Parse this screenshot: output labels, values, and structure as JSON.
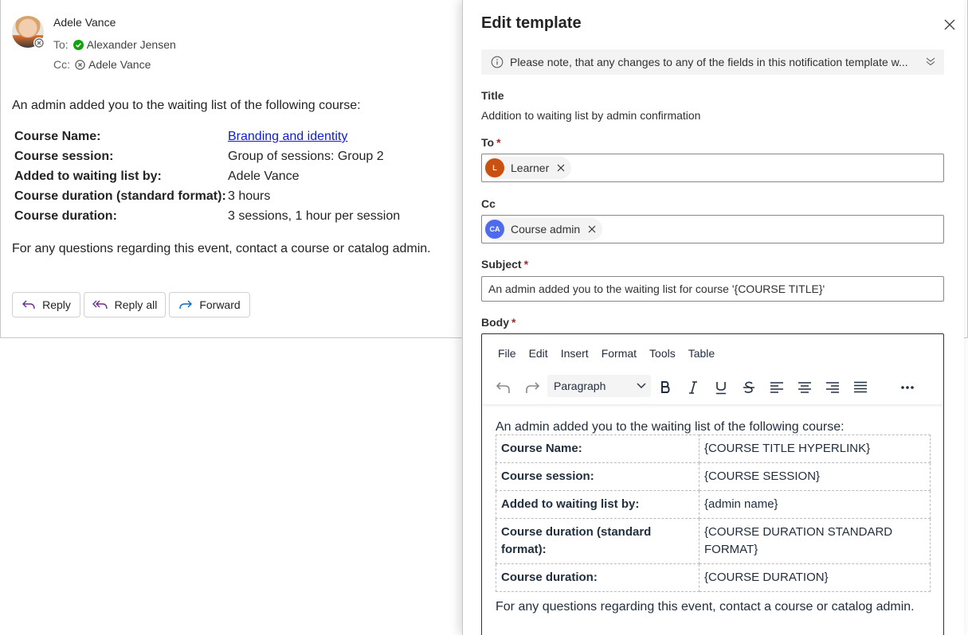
{
  "email": {
    "sender": "Adele Vance",
    "to_label": "To:",
    "to_name": "Alexander Jensen",
    "cc_label": "Cc:",
    "cc_name": "Adele Vance",
    "intro": "An admin added you to the waiting list of the following course:",
    "rows": [
      {
        "key": "Course Name:",
        "value": "Branding and identity",
        "link": true
      },
      {
        "key": "Course session:",
        "value": "Group of sessions: Group 2"
      },
      {
        "key": "Added to waiting list by:",
        "value": "Adele Vance"
      },
      {
        "key": "Course duration (standard format):",
        "value": "3 hours"
      },
      {
        "key": "Course duration:",
        "value": "3 sessions, 1 hour per session"
      }
    ],
    "outro": "For any questions regarding this event, contact a course or catalog admin.",
    "actions": {
      "reply": "Reply",
      "reply_all": "Reply all",
      "forward": "Forward"
    }
  },
  "panel": {
    "title": "Edit template",
    "notice": "Please note, that any changes to any of the fields in this notification template w...",
    "title_label": "Title",
    "title_value": "Addition to waiting list by admin confirmation",
    "to_label": "To",
    "to_chip": {
      "initial": "L",
      "name": "Learner",
      "color": "#ca5010"
    },
    "cc_label": "Cc",
    "cc_chip": {
      "initial": "CA",
      "name": "Course admin",
      "color": "#4f6bed"
    },
    "subject_label": "Subject",
    "subject_value": "An admin added you to the waiting list for course '{COURSE TITLE}'",
    "body_label": "Body",
    "required_mark": "*",
    "menu": [
      "File",
      "Edit",
      "Insert",
      "Format",
      "Tools",
      "Table"
    ],
    "block_format": "Paragraph",
    "body": {
      "intro": "An admin added you to the waiting list of the following course:",
      "rows": [
        {
          "key": "Course Name:",
          "value": "{COURSE TITLE HYPERLINK}"
        },
        {
          "key": "Course session:",
          "value": "{COURSE SESSION}"
        },
        {
          "key": "Added to waiting list by:",
          "value": "{admin name}"
        },
        {
          "key": "Course duration (standard format):",
          "value": "{COURSE DURATION STANDARD FORMAT}"
        },
        {
          "key": "Course duration:",
          "value": "{COURSE DURATION}"
        }
      ],
      "outro": "For any questions regarding this event, contact a course or catalog admin."
    }
  },
  "colors": {
    "accent": "#0f6cbd",
    "link": "#0f1bd6",
    "presence_available": "#13a10e",
    "required": "#a4262c"
  }
}
